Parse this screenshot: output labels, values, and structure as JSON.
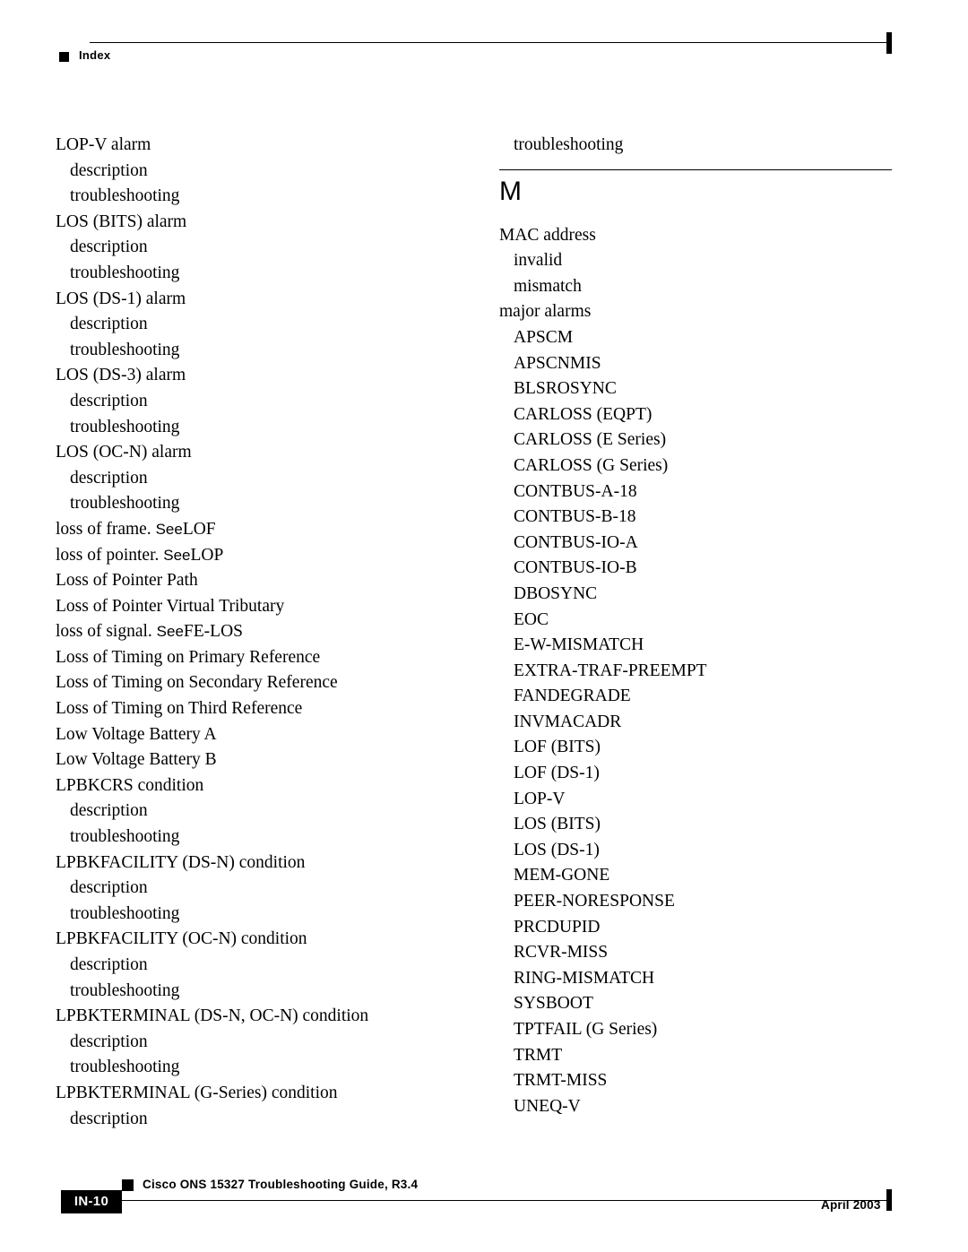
{
  "header": {
    "label": "Index",
    "bullet_icon": "black-square-bullet",
    "tab_icon": "page-edge-tab"
  },
  "footer": {
    "page_number": "IN-10",
    "bullet_icon": "black-square-bullet",
    "document_title": "Cisco ONS 15327 Troubleshooting Guide, R3.4",
    "date": "April 2003",
    "tab_icon": "page-edge-tab"
  },
  "colors": {
    "text": "#000000",
    "rule": "#000000",
    "page_background": "#ffffff",
    "page_number_text": "#ffffff",
    "page_number_background": "#000000"
  },
  "columns": [
    {
      "id": "left",
      "blocks": [
        {
          "type": "entries",
          "entries": [
            {
              "level": 1,
              "text": "LOP-V alarm"
            },
            {
              "level": 2,
              "text": "description"
            },
            {
              "level": 2,
              "text": "troubleshooting"
            },
            {
              "level": 1,
              "text": "LOS (BITS) alarm"
            },
            {
              "level": 2,
              "text": "description"
            },
            {
              "level": 2,
              "text": "troubleshooting"
            },
            {
              "level": 1,
              "text": "LOS (DS-1) alarm"
            },
            {
              "level": 2,
              "text": "description"
            },
            {
              "level": 2,
              "text": "troubleshooting"
            },
            {
              "level": 1,
              "text": "LOS (DS-3) alarm"
            },
            {
              "level": 2,
              "text": "description"
            },
            {
              "level": 2,
              "text": "troubleshooting"
            },
            {
              "level": 1,
              "text": "LOS (OC-N) alarm"
            },
            {
              "level": 2,
              "text": "description"
            },
            {
              "level": 2,
              "text": "troubleshooting"
            },
            {
              "level": 1,
              "text": "loss of frame. ",
              "see": "See",
              "see_target": "LOF"
            },
            {
              "level": 1,
              "text": "loss of pointer. ",
              "see": "See",
              "see_target": "LOP"
            },
            {
              "level": 1,
              "text": "Loss of Pointer Path"
            },
            {
              "level": 1,
              "text": "Loss of Pointer Virtual Tributary"
            },
            {
              "level": 1,
              "text": "loss of signal. ",
              "see": "See",
              "see_target": "FE-LOS"
            },
            {
              "level": 1,
              "text": "Loss of Timing on Primary Reference"
            },
            {
              "level": 1,
              "text": "Loss of Timing on Secondary Reference"
            },
            {
              "level": 1,
              "text": "Loss of Timing on Third Reference"
            },
            {
              "level": 1,
              "text": "Low Voltage Battery A"
            },
            {
              "level": 1,
              "text": "Low Voltage Battery B"
            },
            {
              "level": 1,
              "text": "LPBKCRS condition"
            },
            {
              "level": 2,
              "text": "description"
            },
            {
              "level": 2,
              "text": "troubleshooting"
            },
            {
              "level": 1,
              "text": "LPBKFACILITY (DS-N) condition"
            },
            {
              "level": 2,
              "text": "description"
            },
            {
              "level": 2,
              "text": "troubleshooting"
            },
            {
              "level": 1,
              "text": "LPBKFACILITY (OC-N) condition"
            },
            {
              "level": 2,
              "text": "description"
            },
            {
              "level": 2,
              "text": "troubleshooting"
            },
            {
              "level": 1,
              "text": "LPBKTERMINAL (DS-N, OC-N) condition"
            },
            {
              "level": 2,
              "text": "description"
            },
            {
              "level": 2,
              "text": "troubleshooting"
            },
            {
              "level": 1,
              "text": "LPBKTERMINAL (G-Series) condition"
            },
            {
              "level": 2,
              "text": "description"
            }
          ]
        }
      ]
    },
    {
      "id": "right",
      "blocks": [
        {
          "type": "entries",
          "entries": [
            {
              "level": 2,
              "text": "troubleshooting"
            }
          ]
        },
        {
          "type": "section",
          "letter": "M"
        },
        {
          "type": "entries",
          "entries": [
            {
              "level": 1,
              "text": "MAC address"
            },
            {
              "level": 2,
              "text": "invalid"
            },
            {
              "level": 2,
              "text": "mismatch"
            },
            {
              "level": 1,
              "text": "major alarms"
            },
            {
              "level": 2,
              "text": "APSCM"
            },
            {
              "level": 2,
              "text": "APSCNMIS"
            },
            {
              "level": 2,
              "text": "BLSROSYNC"
            },
            {
              "level": 2,
              "text": "CARLOSS (EQPT)"
            },
            {
              "level": 2,
              "text": "CARLOSS (E Series)"
            },
            {
              "level": 2,
              "text": "CARLOSS (G Series)"
            },
            {
              "level": 2,
              "text": "CONTBUS-A-18"
            },
            {
              "level": 2,
              "text": "CONTBUS-B-18"
            },
            {
              "level": 2,
              "text": "CONTBUS-IO-A"
            },
            {
              "level": 2,
              "text": "CONTBUS-IO-B"
            },
            {
              "level": 2,
              "text": "DBOSYNC"
            },
            {
              "level": 2,
              "text": "EOC"
            },
            {
              "level": 2,
              "text": "E-W-MISMATCH"
            },
            {
              "level": 2,
              "text": "EXTRA-TRAF-PREEMPT"
            },
            {
              "level": 2,
              "text": "FANDEGRADE"
            },
            {
              "level": 2,
              "text": "INVMACADR"
            },
            {
              "level": 2,
              "text": "LOF (BITS)"
            },
            {
              "level": 2,
              "text": "LOF (DS-1)"
            },
            {
              "level": 2,
              "text": "LOP-V"
            },
            {
              "level": 2,
              "text": "LOS (BITS)"
            },
            {
              "level": 2,
              "text": "LOS (DS-1)"
            },
            {
              "level": 2,
              "text": "MEM-GONE"
            },
            {
              "level": 2,
              "text": "PEER-NORESPONSE"
            },
            {
              "level": 2,
              "text": "PRCDUPID"
            },
            {
              "level": 2,
              "text": "RCVR-MISS"
            },
            {
              "level": 2,
              "text": "RING-MISMATCH"
            },
            {
              "level": 2,
              "text": "SYSBOOT"
            },
            {
              "level": 2,
              "text": "TPTFAIL (G Series)"
            },
            {
              "level": 2,
              "text": "TRMT"
            },
            {
              "level": 2,
              "text": "TRMT-MISS"
            },
            {
              "level": 2,
              "text": "UNEQ-V"
            }
          ]
        }
      ]
    }
  ]
}
